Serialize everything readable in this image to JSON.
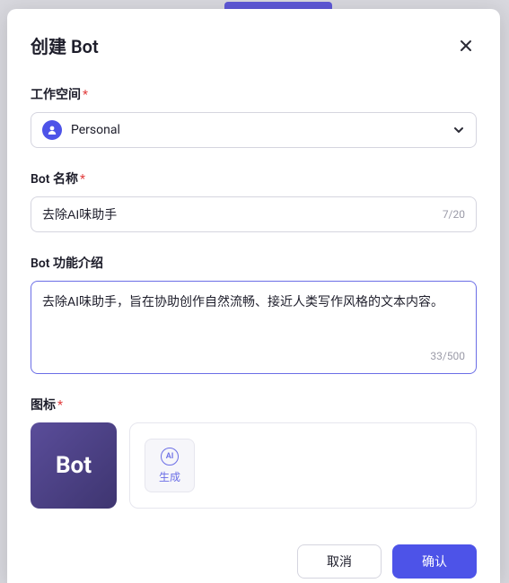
{
  "modal": {
    "title": "创建 Bot"
  },
  "workspace": {
    "label": "工作空间",
    "value": "Personal"
  },
  "name": {
    "label": "Bot 名称",
    "value": "去除AI味助手",
    "count": "7/20"
  },
  "description": {
    "label": "Bot 功能介绍",
    "value": "去除AI味助手，旨在协助创作自然流畅、接近人类写作风格的文本内容。",
    "count": "33/500"
  },
  "icon": {
    "label": "图标",
    "preview_text": "Bot",
    "generate_label": "生成",
    "ai_badge": "AI"
  },
  "footer": {
    "cancel": "取消",
    "confirm": "确认"
  }
}
